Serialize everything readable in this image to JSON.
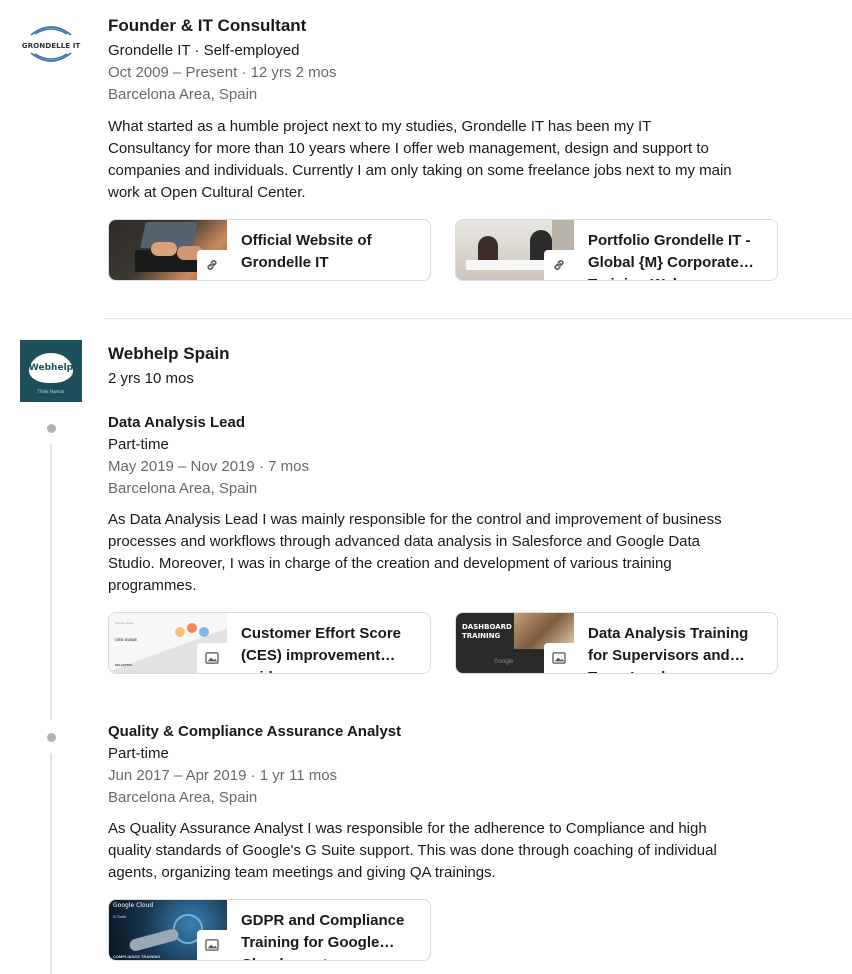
{
  "experience": {
    "grondelle": {
      "logo_text": "GRONDELLE IT",
      "title": "Founder & IT Consultant",
      "company_line": "Grondelle IT · Self-employed",
      "dates": "Oct 2009 – Present",
      "duration": "· 12 yrs 2 mos",
      "location": "Barcelona Area, Spain",
      "description_lines": [
        "What started as a humble project next to my studies, Grondelle IT has been my IT",
        "Consultancy for more than 10 years where I offer web management, design and support to",
        "companies and individuals. Currently I am only taking on some freelance jobs next to my main",
        "work at Open Cultural Center."
      ],
      "media": [
        {
          "label": "Official Website of Grondelle IT",
          "icon": "link-icon"
        },
        {
          "label": "Portfolio Grondelle IT - Global {M} Corporate Training Web Development",
          "icon": "link-icon"
        }
      ]
    },
    "webhelp": {
      "logo_text": "Webhelp",
      "logo_tagline": "Think Human",
      "company": "Webhelp Spain",
      "total_duration": "2 yrs 10 mos",
      "roles": [
        {
          "title": "Data Analysis Lead",
          "type": "Part-time",
          "dates": "May 2019 – Nov 2019",
          "duration": "· 7 mos",
          "location": "Barcelona Area, Spain",
          "description_lines": [
            "As Data Analysis Lead I was mainly responsible for the control and improvement of business",
            "processes and workflows through advanced data analysis in Salesforce and Google Data",
            "Studio. Moreover, I was in charge of the creation and development of various training",
            "programmes."
          ],
          "media": [
            {
              "label": "Customer Effort Score (CES) improvement guide",
              "icon": "image-icon",
              "thumb_texts": [
                "Google Cloud",
                "CES GUIDE",
                "SELLBYTEL"
              ]
            },
            {
              "label": "Data Analysis Training for Supervisors and Team Leaders",
              "icon": "image-icon",
              "thumb_texts": [
                "DASHBOARD",
                "TRAINING",
                "Google"
              ]
            }
          ]
        },
        {
          "title": "Quality & Compliance Assurance Analyst",
          "type": "Part-time",
          "dates": "Jun 2017 – Apr 2019",
          "duration": "· 1 yr 11 mos",
          "location": "Barcelona Area, Spain",
          "description_lines": [
            "As Quality Assurance Analyst I was responsible for the adherence to Compliance and high",
            "quality standards of Google's G Suite support. This was done through coaching of individual",
            "agents, organizing team meetings and giving QA trainings."
          ],
          "media": [
            {
              "label": "GDPR and Compliance Training for Google Cloud agents",
              "icon": "image-icon",
              "thumb_texts": [
                "Google Cloud",
                "G Suite",
                "COMPLIANCE TRAINING"
              ]
            }
          ]
        }
      ]
    }
  }
}
